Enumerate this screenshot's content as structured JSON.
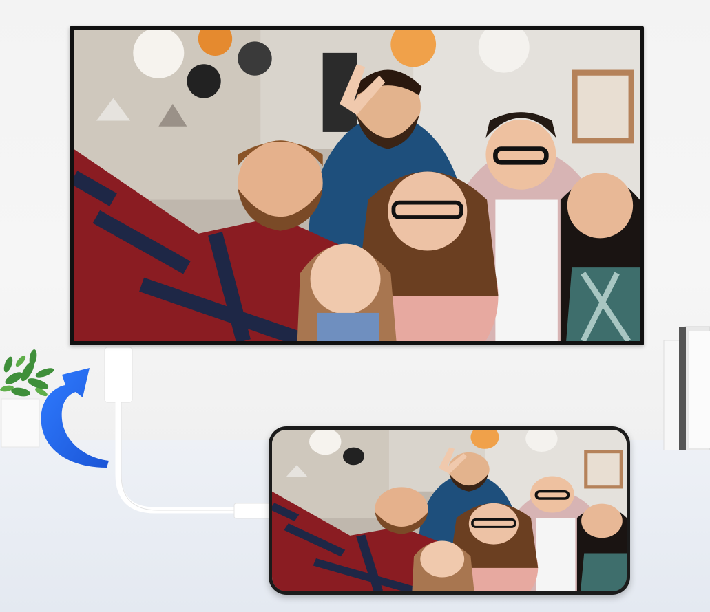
{
  "scene": {
    "description_tag": "",
    "colors": {
      "tv_frame": "#111111",
      "phone_frame": "#1b1b1b",
      "arrow": "#2b6df2",
      "cable": "#ffffff"
    },
    "icons": {
      "arrow": "curved-arrow-up-icon",
      "plant": "potted-plant-icon",
      "books": "books-icon"
    }
  }
}
